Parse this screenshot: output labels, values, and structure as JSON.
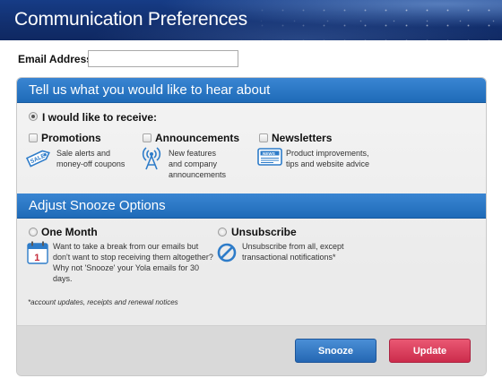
{
  "header": {
    "title": "Communication Preferences"
  },
  "email": {
    "label": "Email Address:",
    "value": "",
    "placeholder": ""
  },
  "receive_section": {
    "heading": "Tell us what you would like to hear about",
    "option_label": "I would like to receive:",
    "option_selected": true,
    "items": [
      {
        "label": "Promotions",
        "description_lines": [
          "Sale alerts and",
          "money-off coupons"
        ],
        "icon": "sale-tag-icon",
        "checked": false
      },
      {
        "label": "Announcements",
        "description_lines": [
          "New features",
          "and company",
          "announcements"
        ],
        "icon": "broadcast-tower-icon",
        "checked": false
      },
      {
        "label": "Newsletters",
        "description_lines": [
          "Product improvements,",
          "tips and website advice"
        ],
        "icon": "newspaper-icon",
        "icon_text": "NEWS",
        "checked": false
      }
    ]
  },
  "snooze_section": {
    "heading": "Adjust Snooze Options",
    "options": [
      {
        "label": "One Month",
        "description_lines": [
          "Want to take a break from our emails but",
          "don't want to stop receiving them altogether?",
          "Why not 'Snooze' your Yola emails for 30",
          "days."
        ],
        "icon": "calendar-icon",
        "icon_text": "1",
        "selected": false
      },
      {
        "label": "Unsubscribe",
        "description_lines": [
          "Unsubscribe from all, except",
          "transactional notifications*"
        ],
        "icon": "no-entry-icon",
        "selected": false
      }
    ],
    "footnote": "*account updates, receipts and renewal notices"
  },
  "buttons": {
    "snooze": "Snooze",
    "update": "Update"
  },
  "colors": {
    "header_bg": "#143575",
    "section_blue": "#2a76c4",
    "snooze_button": "#2f73bd",
    "update_button": "#dc3d5c",
    "icon_blue": "#2e7cc9"
  }
}
